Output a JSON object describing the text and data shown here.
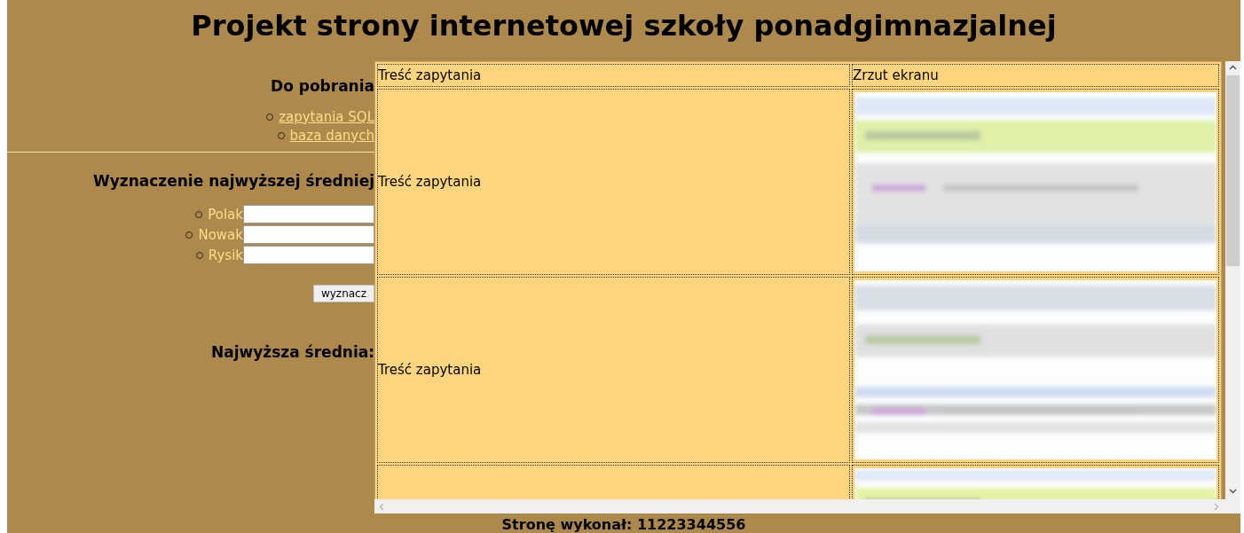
{
  "title": "Projekt strony internetowej szkoły ponadgimnazjalnej",
  "downloads": {
    "heading": "Do pobrania",
    "links": [
      "zapytania SQL",
      "baza danych"
    ]
  },
  "form": {
    "heading": "Wyznaczenie najwyższej średniej",
    "fields": [
      {
        "label": "Polak"
      },
      {
        "label": "Nowak"
      },
      {
        "label": "Rysik"
      }
    ],
    "button": "wyznacz",
    "result_label": "Najwyższa średnia:"
  },
  "table": {
    "columns": [
      "Treść zapytania",
      "Zrzut ekranu"
    ],
    "rows": [
      {
        "query": "Treść zapytania",
        "screenshot": {
          "kind": "picture"
        }
      },
      {
        "query": "Treść zapytania",
        "screenshot": {
          "kind": "picture"
        }
      },
      {
        "screenshot": {
          "kind": "picture"
        }
      }
    ]
  },
  "footer": "Stronę wykonał: 11223344556"
}
